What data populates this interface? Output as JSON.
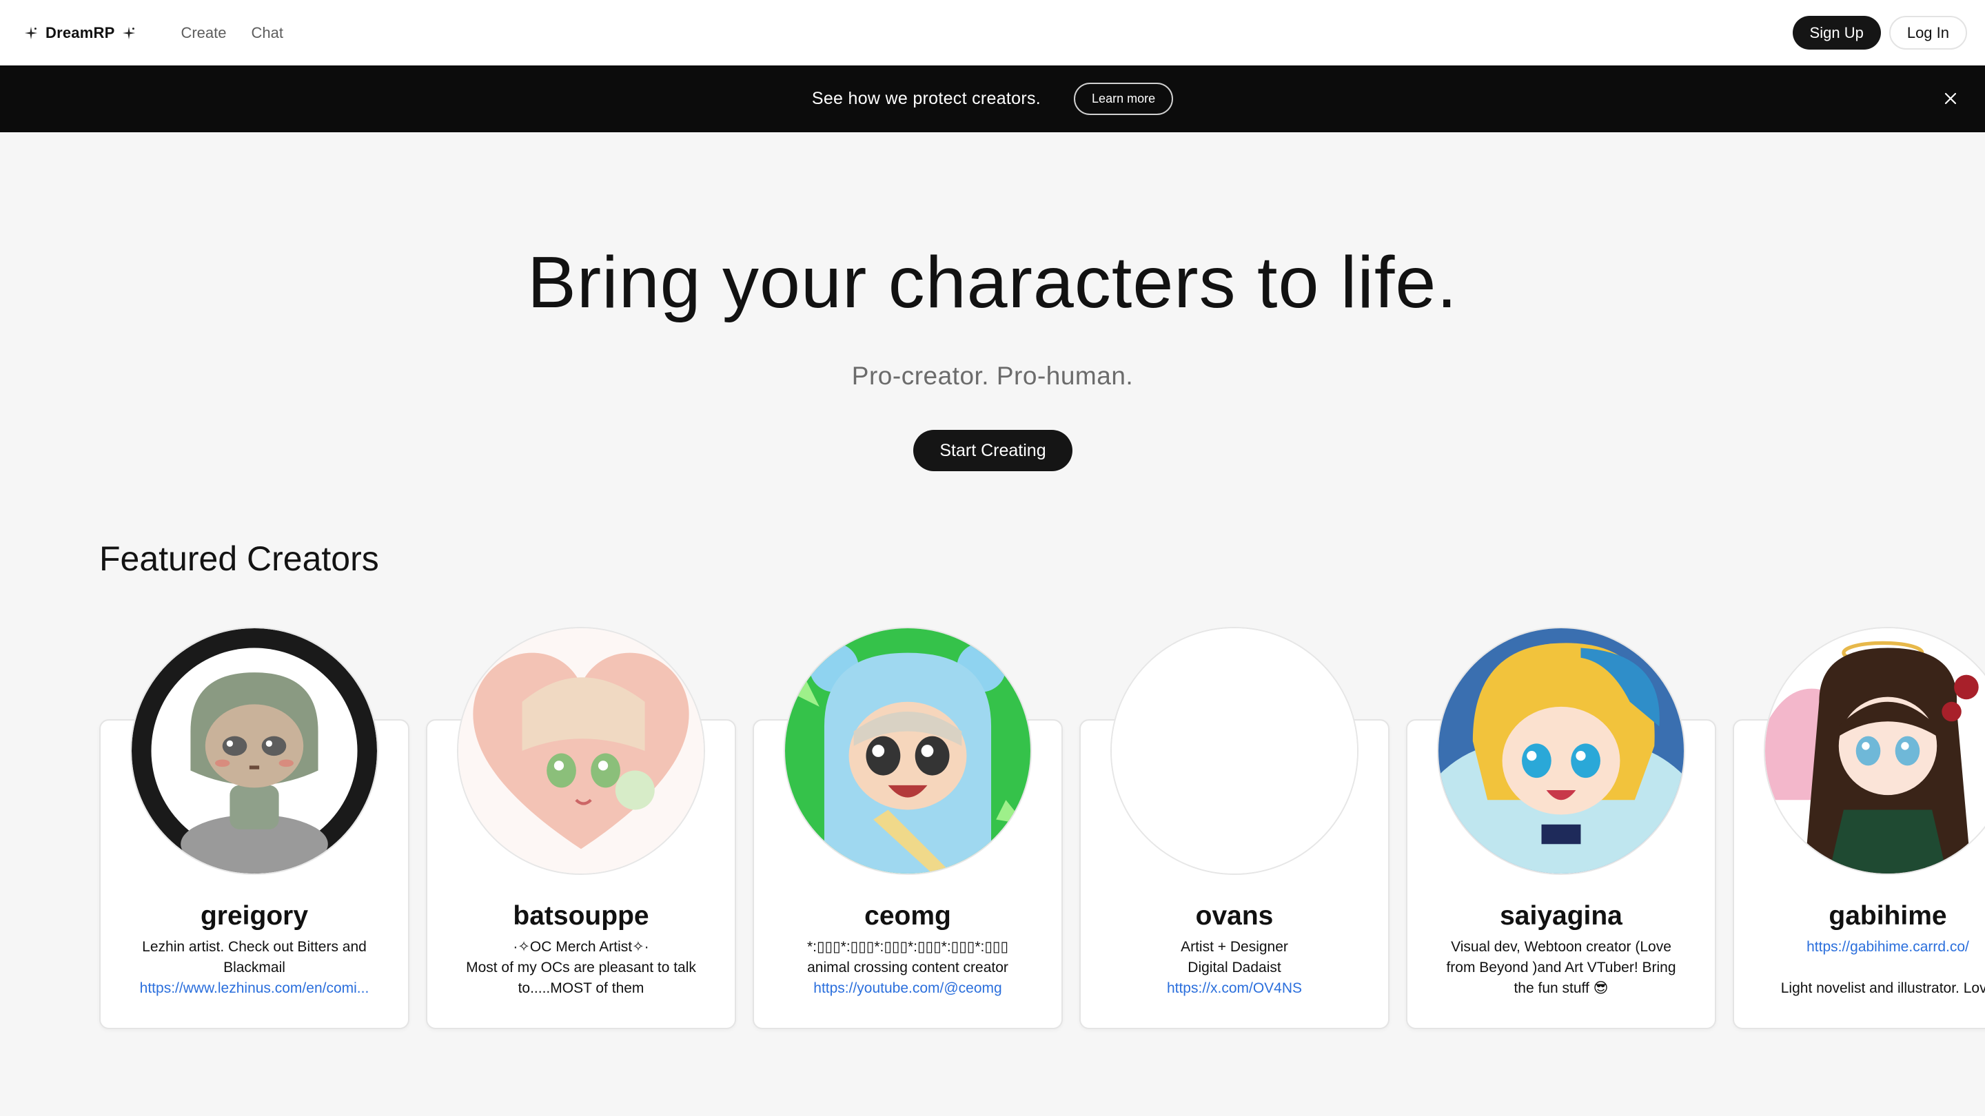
{
  "nav": {
    "brand": "DreamRP",
    "links": [
      "Create",
      "Chat"
    ],
    "signup": "Sign Up",
    "login": "Log In"
  },
  "banner": {
    "text": "See how we protect creators.",
    "button": "Learn more"
  },
  "hero": {
    "title": "Bring your characters to life.",
    "subtitle": "Pro-creator. Pro-human.",
    "cta": "Start Creating"
  },
  "featured": {
    "title": "Featured Creators",
    "creators": [
      {
        "name": "greigory",
        "bio": [
          "Lezhin artist. Check out Bitters and",
          "Blackmail"
        ],
        "link": "https://www.lezhinus.com/en/comi..."
      },
      {
        "name": "batsouppe",
        "bio": [
          "·✧OC Merch Artist✧·",
          "Most of my OCs are pleasant to talk",
          "to.....MOST of them"
        ],
        "link": ""
      },
      {
        "name": "ceomg",
        "bio": [
          "*:▯▯▯*:▯▯▯*:▯▯▯*:▯▯▯*:▯▯▯*:▯▯▯",
          "animal crossing content creator"
        ],
        "link": "https://youtube.com/@ceomg"
      },
      {
        "name": "ovans",
        "bio": [
          "Artist + Designer",
          "Digital Dadaist"
        ],
        "link": "https://x.com/OV4NS"
      },
      {
        "name": "saiyagina",
        "bio": [
          "Visual dev, Webtoon creator (Love",
          "from Beyond )and Art VTuber! Bring",
          "the fun stuff 😎"
        ],
        "link": ""
      },
      {
        "name": "gabihime",
        "bio": [
          "Light novelist and illustrator. Love"
        ],
        "link": "https://gabihime.carrd.co/"
      }
    ]
  },
  "colors": {
    "accent_dark": "#151515",
    "link": "#2b6fdc",
    "banner_bg": "#0c0c0c",
    "page_bg": "#f6f6f6"
  }
}
